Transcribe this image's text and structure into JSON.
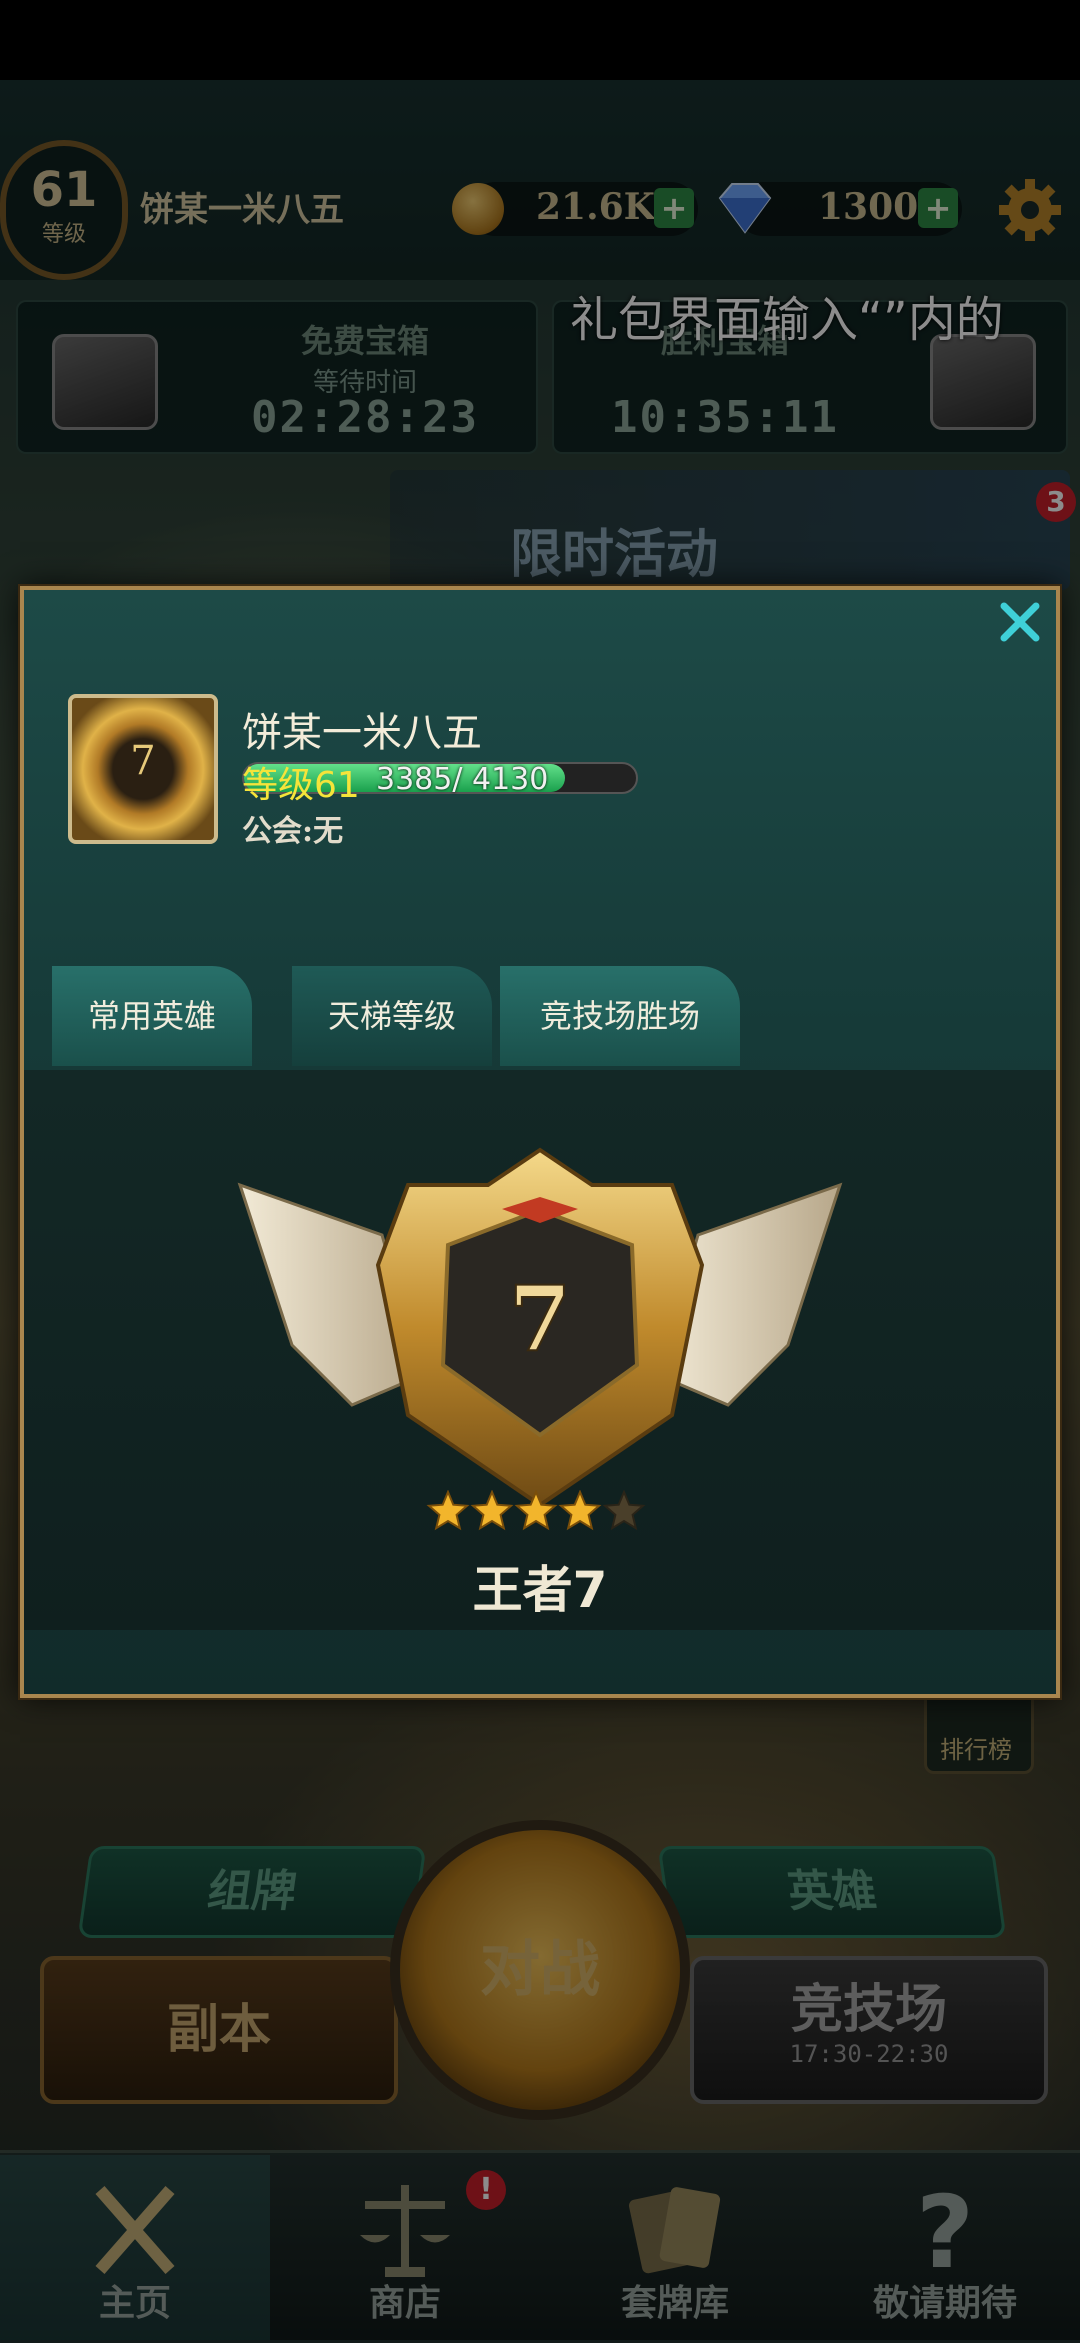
{
  "player": {
    "level": "61",
    "level_label": "等级",
    "name": "饼某一米八五"
  },
  "currency": {
    "gold": "21.6K",
    "gems": "1300",
    "plus": "+"
  },
  "marquee": "礼包界面输入“”内的",
  "chests": [
    {
      "title": "免费宝箱",
      "subtitle": "等待时间",
      "time": "02:28:23"
    },
    {
      "title": "胜利宝箱",
      "time": "10:35:11"
    }
  ],
  "event": {
    "title": "限时活动",
    "badge": "3"
  },
  "menu": {
    "deck": "组牌",
    "hero": "英雄",
    "dungeon": "副本",
    "battle": "对战",
    "arena": "竞技场",
    "arena_time": "17:30-22:30",
    "ranking": "排行榜"
  },
  "nav": {
    "home": "主页",
    "shop": "商店",
    "shop_badge": "!",
    "deck_library": "套牌库",
    "coming_soon": "敬请期待"
  },
  "profile": {
    "name": "饼某一米八五",
    "level_prefix": "等级",
    "level": "61",
    "xp_current": 3385,
    "xp_max": 4130,
    "xp_text": "3385/ 4130",
    "guild": "公会:无",
    "avatar_rank": "7",
    "tabs": [
      "常用英雄",
      "天梯等级",
      "竞技场胜场"
    ],
    "active_tab": "天梯等级",
    "rank_number": "7",
    "rank_name": "王者7",
    "stars_filled": 4,
    "stars_total": 5
  },
  "colors": {
    "accent_teal": "#28807c",
    "gold_frame": "#a9864e",
    "xp_green": "#1aa04d",
    "level_yellow": "#f5e43a"
  }
}
